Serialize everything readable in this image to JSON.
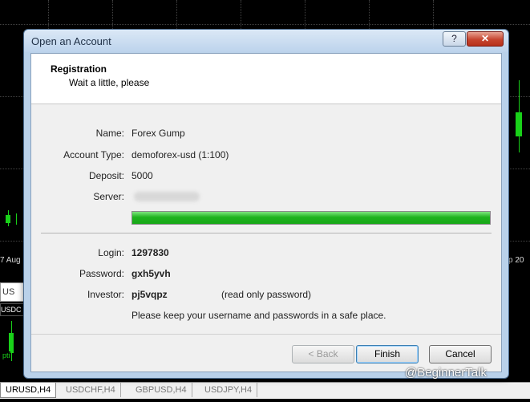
{
  "dialog": {
    "title": "Open an Account",
    "help_glyph": "?",
    "close_glyph": "✕",
    "header": {
      "title": "Registration",
      "subtitle": "Wait a little, please"
    },
    "fields": {
      "name_label": "Name:",
      "name_value": "Forex Gump",
      "account_type_label": "Account Type:",
      "account_type_value": "demoforex-usd (1:100)",
      "deposit_label": "Deposit:",
      "deposit_value": "5000",
      "server_label": "Server:"
    },
    "progress_fraction": 1.0,
    "credentials": {
      "login_label": "Login:",
      "login_value": "1297830",
      "password_label": "Password:",
      "password_value": "gxh5yvh",
      "investor_label": "Investor:",
      "investor_value": "pj5vqpz",
      "investor_note": "(read only password)",
      "safety_note": "Please keep your username and passwords in a safe place."
    },
    "buttons": {
      "back": "< Back",
      "finish": "Finish",
      "cancel": "Cancel"
    }
  },
  "background": {
    "date_left": "7 Aug",
    "date_right": "p 20",
    "side_label_1": "US",
    "side_label_2": "USDC",
    "side_label_3": "pti"
  },
  "tabs": [
    "URUSD,H4",
    "USDCHF,H4",
    "GBPUSD,H4",
    "USDJPY,H4"
  ],
  "watermark": "@BeginnerTalk",
  "colors": {
    "progress": "#1fb31f",
    "chart_bg": "#000000",
    "candle": "#19d119"
  }
}
